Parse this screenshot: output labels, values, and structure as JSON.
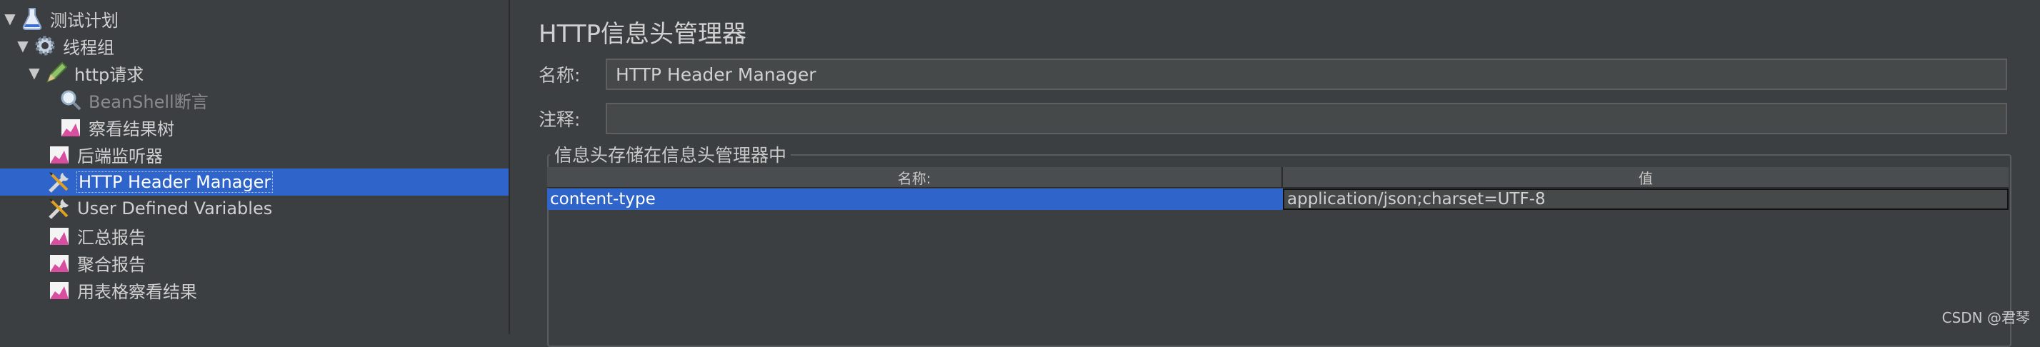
{
  "tree": {
    "items": [
      {
        "label": "测试计划",
        "icon": "flask-icon",
        "expanded": true
      },
      {
        "label": "线程组",
        "icon": "gear-icon",
        "expanded": true
      },
      {
        "label": "http请求",
        "icon": "sampler-pen-icon",
        "expanded": true
      },
      {
        "label": "BeanShell断言",
        "icon": "magnifier-icon",
        "disabled": true
      },
      {
        "label": "察看结果树",
        "icon": "chart-listener-icon"
      },
      {
        "label": "后端监听器",
        "icon": "chart-listener-icon"
      },
      {
        "label": "HTTP Header Manager",
        "icon": "tools-icon",
        "selected": true
      },
      {
        "label": "User Defined Variables",
        "icon": "tools-icon"
      },
      {
        "label": "汇总报告",
        "icon": "chart-listener-icon"
      },
      {
        "label": "聚合报告",
        "icon": "chart-listener-icon"
      },
      {
        "label": "用表格察看结果",
        "icon": "chart-listener-icon"
      }
    ]
  },
  "panel": {
    "title": "HTTP信息头管理器",
    "name_label": "名称:",
    "name_value": "HTTP Header Manager",
    "comment_label": "注释:",
    "comment_value": "",
    "group_title": "信息头存储在信息头管理器中",
    "table": {
      "headers": [
        "名称:",
        "值"
      ],
      "rows": [
        {
          "name": "content-type",
          "value": "application/json;charset=UTF-8"
        }
      ]
    }
  },
  "footer": {
    "watermark": "CSDN @君琴"
  },
  "colors": {
    "selection": "#2f65ca",
    "background": "#3c3f41"
  }
}
